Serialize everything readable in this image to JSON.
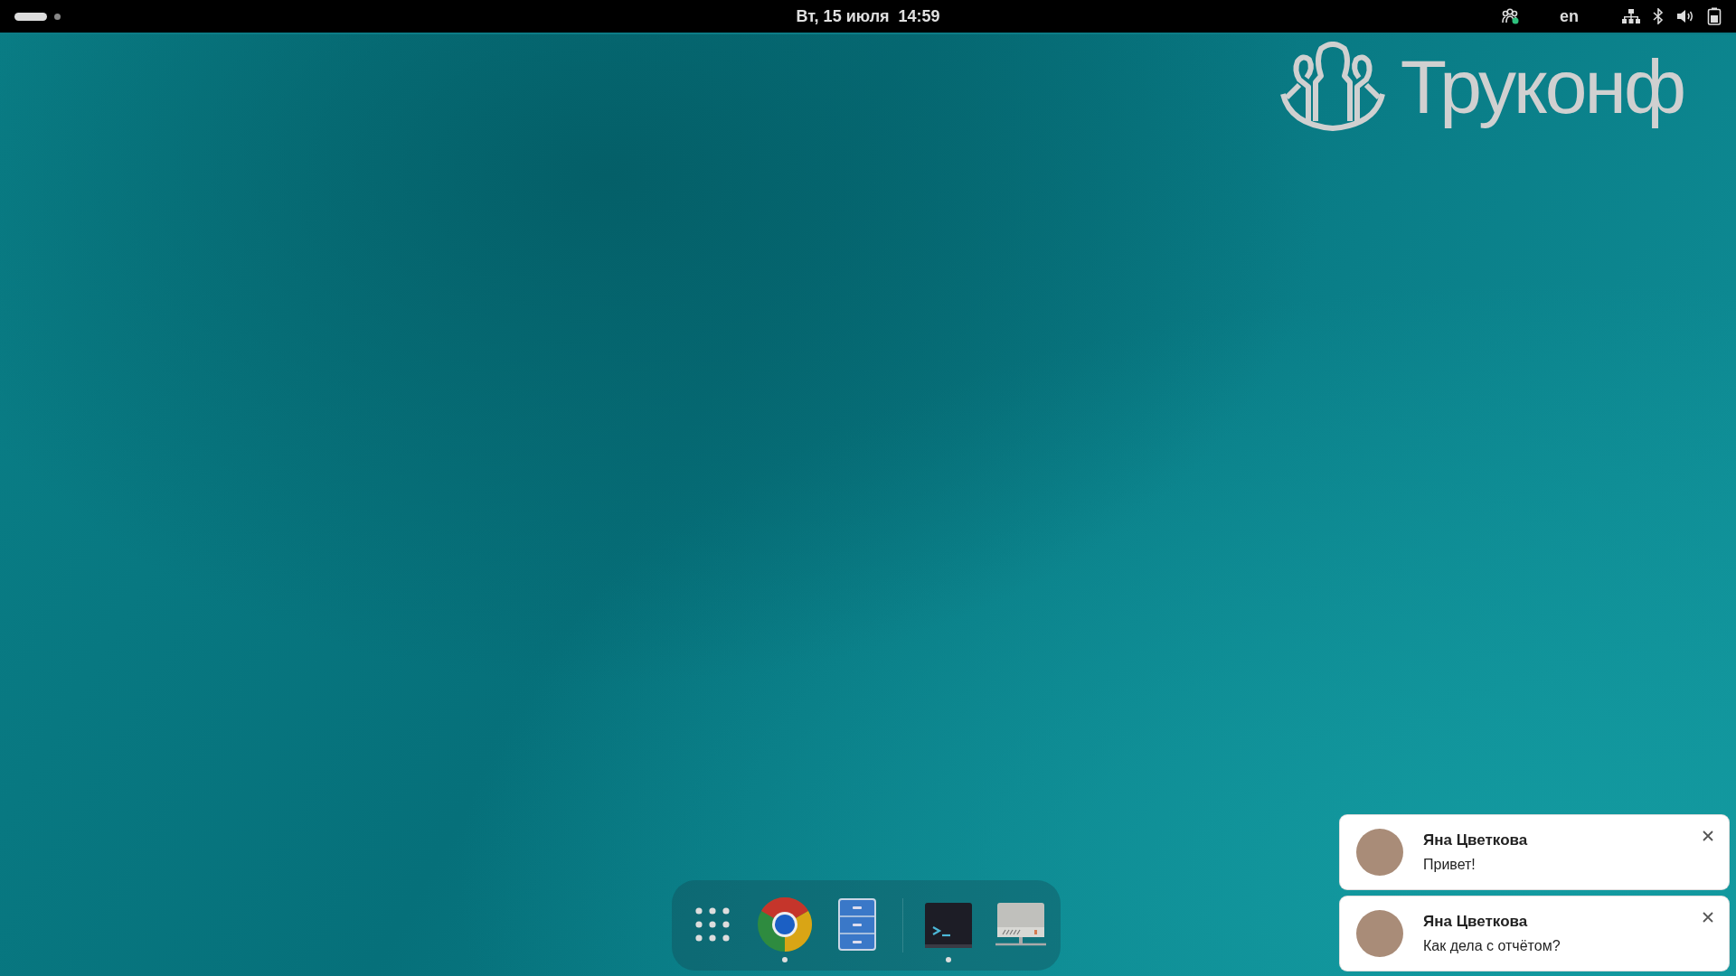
{
  "top_bar": {
    "workspaces": [
      {
        "selected": true
      },
      {
        "selected": false
      }
    ],
    "clock": "Вт, 15 июля  14:59",
    "tray": [
      {
        "kind": "app",
        "badge": true
      },
      {
        "kind": "text",
        "label": "en"
      },
      {
        "kind": "network"
      },
      {
        "kind": "bluetooth"
      },
      {
        "kind": "volume"
      },
      {
        "kind": "battery"
      }
    ]
  },
  "desktop": {
    "logo": {
      "text": "Труконф"
    }
  },
  "dock": {
    "items": [
      {
        "kind": "grid",
        "running": false
      },
      {
        "kind": "browser",
        "running": true
      },
      {
        "kind": "files",
        "running": false
      },
      {
        "kind": "separator"
      },
      {
        "kind": "terminal",
        "running": true
      },
      {
        "kind": "drive",
        "running": false
      }
    ]
  },
  "notifications": [
    {
      "sender": "Яна Цветкова",
      "message": "Привет!"
    },
    {
      "sender": "Яна Цветкова",
      "message": "Как дела с отчётом?"
    }
  ]
}
